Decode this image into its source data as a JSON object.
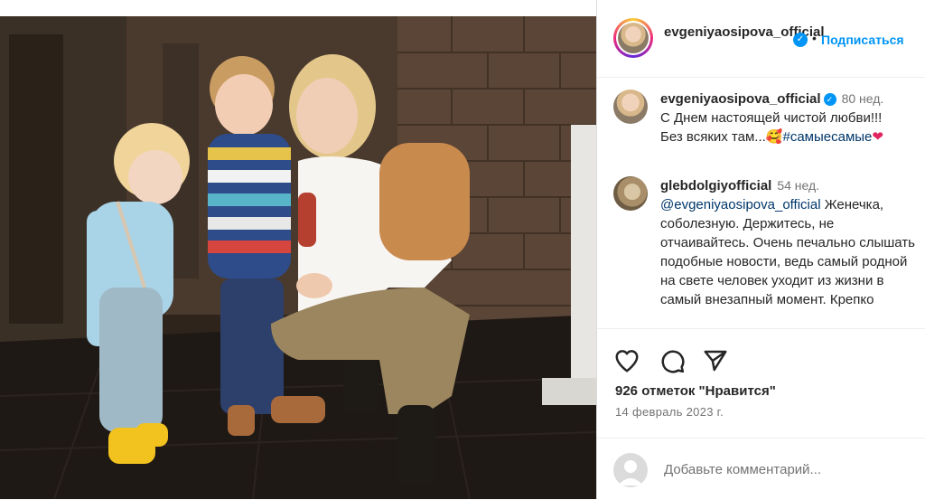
{
  "post": {
    "author": "evgeniyaosipova_official",
    "follow_label": "Подписаться",
    "dot": "•",
    "verified_glyph": "✓"
  },
  "comments": [
    {
      "user": "evgeniyaosipova_official",
      "time": "80 нед.",
      "line1": "С Днем настоящей чистой любви!!!",
      "line2": "Без всяких там...",
      "emoji": "🥰",
      "hashtag": "#самыесамые",
      "heart": "❤"
    },
    {
      "user": "glebdolgiyofficial",
      "time": "54 нед.",
      "mention": "@evgeniyaosipova_official",
      "text": "Женечка, соболезную. Держитесь, не отчаивайтесь. Очень печально слышать подобные новости, ведь самый родной на свете человек уходит из жизни в самый внезапный момент. Крепко"
    }
  ],
  "actions": {
    "like_icon": "heart-outline",
    "comment_icon": "speech-bubble",
    "share_icon": "paper-plane"
  },
  "likes_text": "926 отметок \"Нравится\"",
  "date_text": "14 февраль 2023 г.",
  "add_comment_placeholder": "Добавьте комментарий..."
}
